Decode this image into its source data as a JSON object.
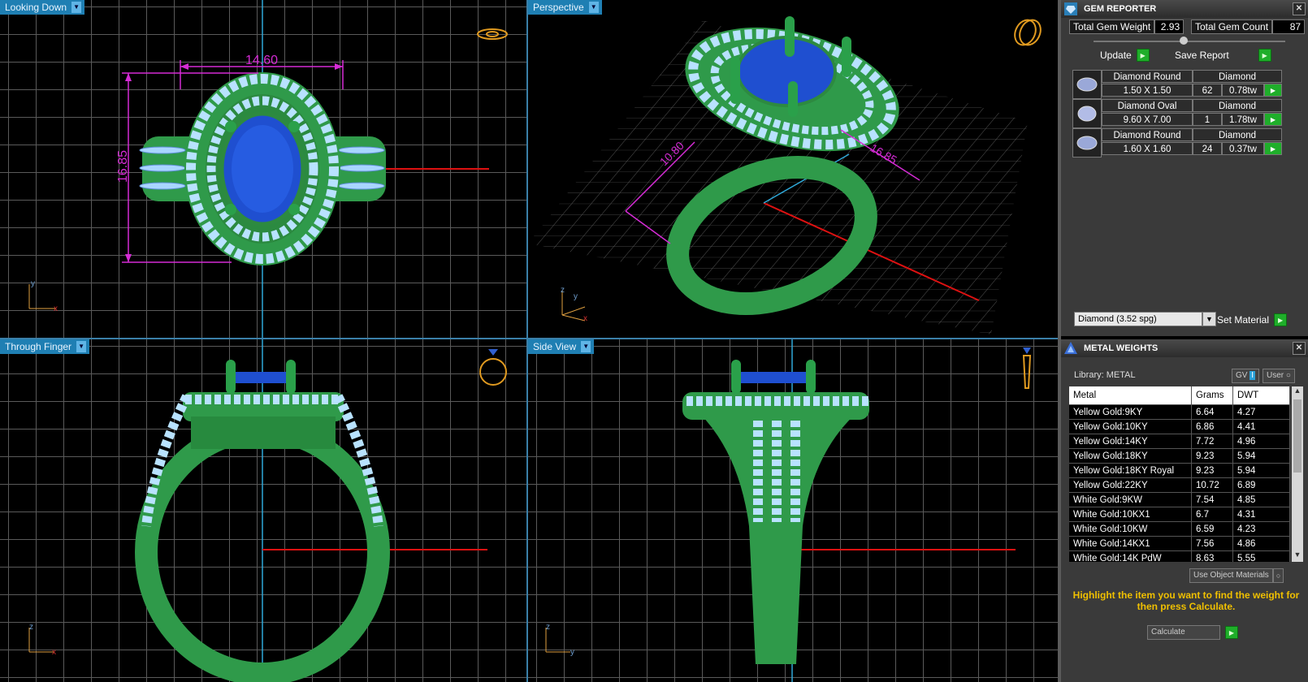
{
  "viewports": {
    "top_left": {
      "label": "Looking Down",
      "dim_width": "14.60",
      "dim_height": "16.85",
      "axis_a": "y",
      "axis_b": "x"
    },
    "top_right": {
      "label": "Perspective",
      "dim_a": "10.80",
      "dim_b": "16.85",
      "axis_a": "z",
      "axis_b": "y",
      "axis_c": "x"
    },
    "bottom_left": {
      "label": "Through Finger",
      "axis_a": "z",
      "axis_b": "x"
    },
    "bottom_right": {
      "label": "Side View",
      "axis_a": "z",
      "axis_b": "y"
    }
  },
  "gem_reporter": {
    "title": "GEM REPORTER",
    "total_weight_label": "Total Gem Weight",
    "total_weight_value": "2.93",
    "total_count_label": "Total Gem Count",
    "total_count_value": "87",
    "update_label": "Update",
    "save_report_label": "Save Report",
    "gems": [
      {
        "shape": "Diamond Round",
        "material": "Diamond",
        "size": "1.50 X 1.50",
        "count": "62",
        "weight": "0.78tw"
      },
      {
        "shape": "Diamond Oval",
        "material": "Diamond",
        "size": "9.60 X 7.00",
        "count": "1",
        "weight": "1.78tw"
      },
      {
        "shape": "Diamond Round",
        "material": "Diamond",
        "size": "1.60 X 1.60",
        "count": "24",
        "weight": "0.37tw"
      }
    ],
    "material_select": "Diamond    (3.52 spg)",
    "set_material_label": "Set Material"
  },
  "metal_weights": {
    "title": "METAL WEIGHTS",
    "library_label": "Library: METAL",
    "gv_label": "GV",
    "user_label": "User",
    "columns": [
      "Metal",
      "Grams",
      "DWT"
    ],
    "rows": [
      [
        "Yellow Gold:9KY",
        "6.64",
        "4.27"
      ],
      [
        "Yellow Gold:10KY",
        "6.86",
        "4.41"
      ],
      [
        "Yellow Gold:14KY",
        "7.72",
        "4.96"
      ],
      [
        "Yellow Gold:18KY",
        "9.23",
        "5.94"
      ],
      [
        "Yellow Gold:18KY Royal",
        "9.23",
        "5.94"
      ],
      [
        "Yellow Gold:22KY",
        "10.72",
        "6.89"
      ],
      [
        "White Gold:9KW",
        "7.54",
        "4.85"
      ],
      [
        "White Gold:10KX1",
        "6.7",
        "4.31"
      ],
      [
        "White Gold:10KW",
        "6.59",
        "4.23"
      ],
      [
        "White Gold:14KX1",
        "7.56",
        "4.86"
      ],
      [
        "White Gold:14K PdW",
        "8.63",
        "5.55"
      ]
    ],
    "use_object_materials_label": "Use Object Materials",
    "instruction": "Highlight the item you want to find the weight for then press Calculate.",
    "calculate_label": "Calculate"
  }
}
